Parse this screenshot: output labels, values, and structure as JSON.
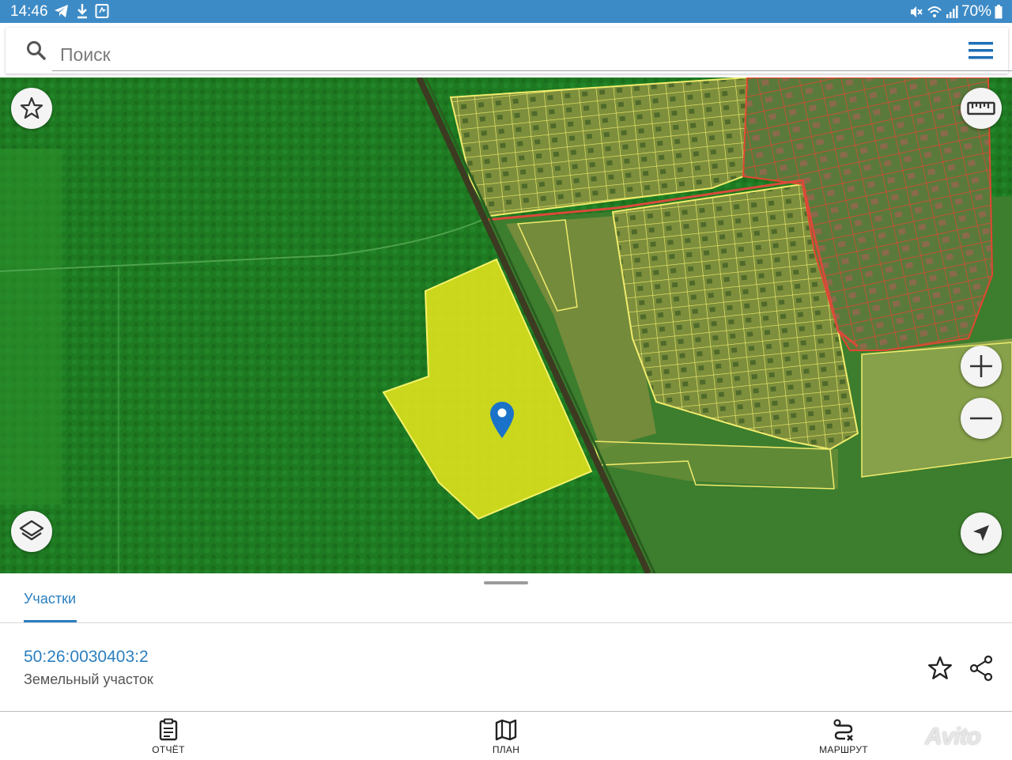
{
  "status_bar": {
    "time": "14:46",
    "battery": "70%",
    "icons_left": [
      "telegram-icon",
      "download-icon",
      "clipboard-icon"
    ],
    "icons_right": [
      "mute-icon",
      "wifi-icon",
      "signal-icon",
      "battery-icon"
    ]
  },
  "search": {
    "placeholder": "Поиск",
    "value": ""
  },
  "map": {
    "buttons": [
      "favorite-button",
      "ruler-button",
      "layers-button",
      "zoom-in-button",
      "zoom-out-button",
      "locate-button"
    ],
    "colors": {
      "forest": "#1f7a22",
      "selected_parcel": "#e2e41c",
      "parcel_outline_yellow": "#f0ec6a",
      "parcel_outline_red": "#e0402c",
      "marker": "#1a73c8"
    }
  },
  "sheet": {
    "tab_label": "Участки",
    "parcel_id": "50:26:0030403:2",
    "parcel_type": "Земельный участок"
  },
  "bottom_nav": {
    "items": [
      {
        "label": "ОТЧЁТ",
        "icon": "report-icon"
      },
      {
        "label": "ПЛАН",
        "icon": "map-icon"
      },
      {
        "label": "МАРШРУТ",
        "icon": "route-icon"
      }
    ]
  },
  "watermark": "Avito"
}
